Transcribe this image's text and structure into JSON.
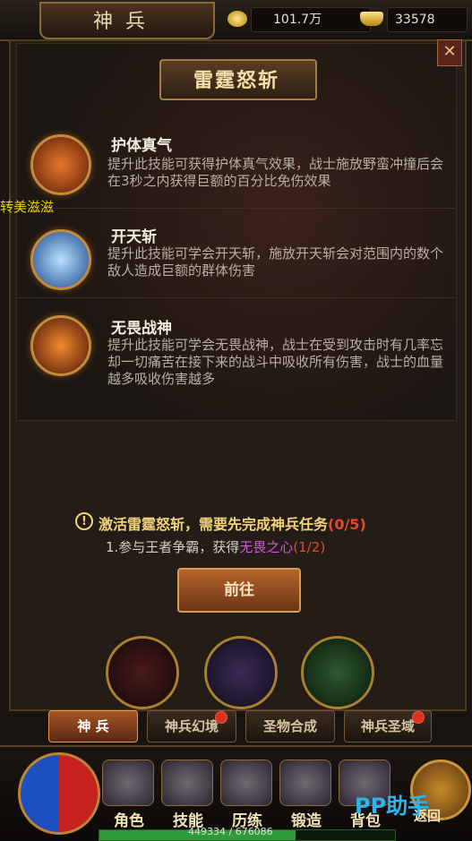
{
  "header": {
    "title": "神兵",
    "gold": "101.7万",
    "ingot": "33578"
  },
  "panel": {
    "banner_title": "雷霆怒斩",
    "side_text": "转美滋滋",
    "skills": [
      {
        "name": "护体真气",
        "desc": "提升此技能可获得护体真气效果，战士施放野蛮冲撞后会在3秒之内获得巨额的百分比免伤效果"
      },
      {
        "name": "开天斩",
        "desc": "提升此技能可学会开天斩，施放开天斩会对范围内的数个敌人造成巨额的群体伤害"
      },
      {
        "name": "无畏战神",
        "desc": "提升此技能可学会无畏战神，战士在受到攻击时有几率忘却一切痛苦在接下来的战斗中吸收所有伤害，战士的血量越多吸收伤害越多"
      }
    ],
    "notice": {
      "text": "激活雷霆怒斩，需要先完成神兵任务",
      "count": "(0/5)"
    },
    "task": {
      "prefix": "1.参与王者争霸，获得",
      "highlight": "无畏之心",
      "count": "(1/2)"
    },
    "go_button": "前往"
  },
  "tabs": [
    {
      "label": "神 兵"
    },
    {
      "label": "神兵幻境"
    },
    {
      "label": "圣物合成"
    },
    {
      "label": "神兵圣域"
    }
  ],
  "menu": [
    {
      "label": "角色"
    },
    {
      "label": "技能"
    },
    {
      "label": "历练"
    },
    {
      "label": "锻造"
    },
    {
      "label": "背包"
    }
  ],
  "watermark": "PP助手",
  "return_label": "返回",
  "xp": {
    "text": "449334 / 676086",
    "fraction": 0.6646
  }
}
